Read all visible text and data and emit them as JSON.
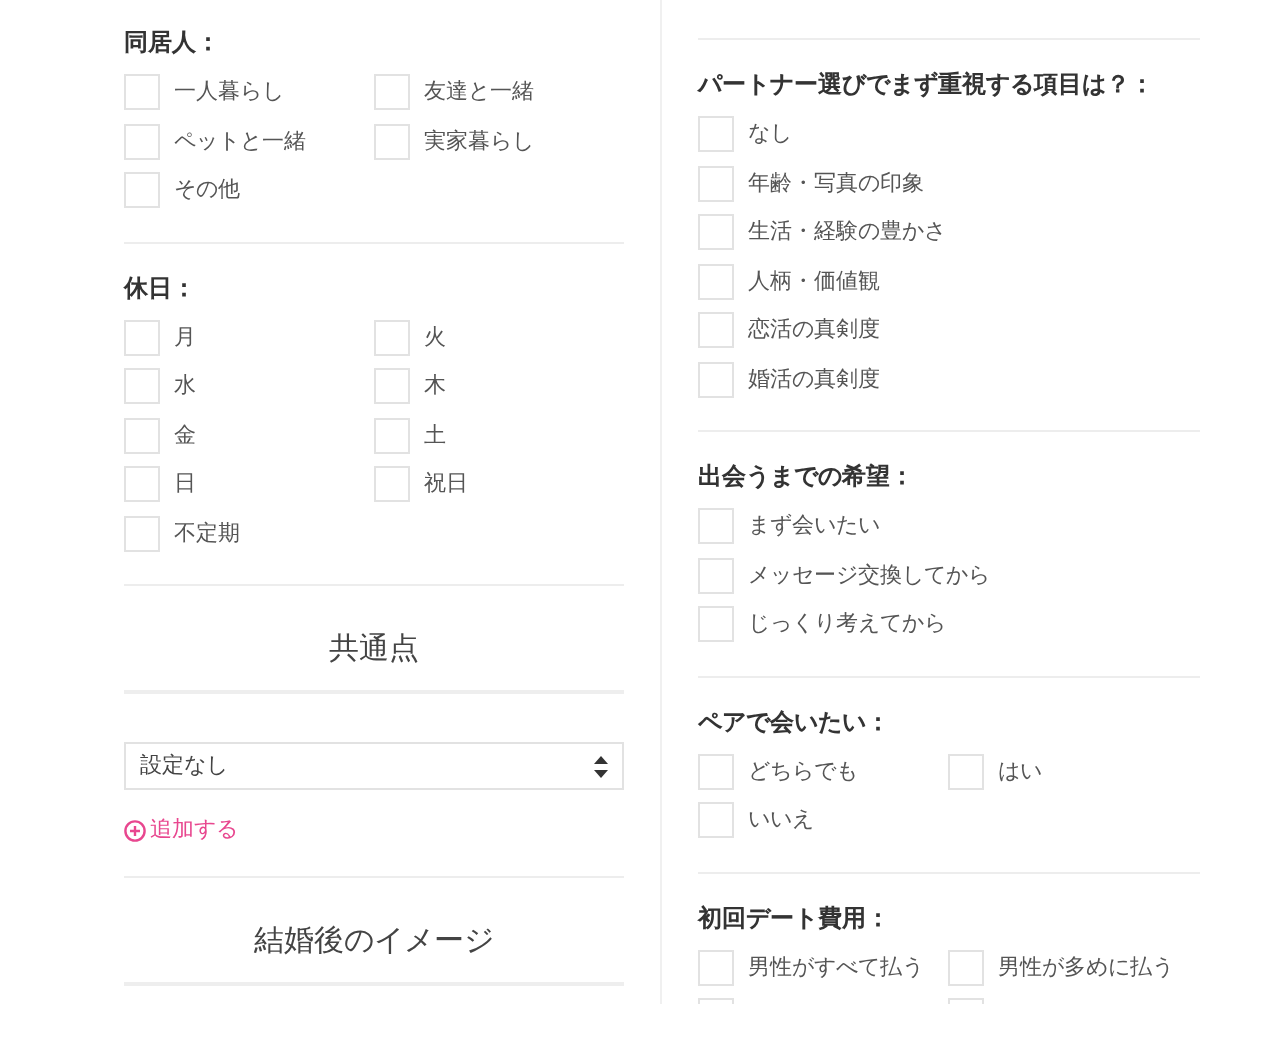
{
  "left": [
    {
      "kind": "checkbox_grid",
      "label": "同居人：",
      "items": [
        {
          "label": "一人暮らし",
          "checked": false
        },
        {
          "label": "友達と一緒",
          "checked": false
        },
        {
          "label": "ペットと一緒",
          "checked": false
        },
        {
          "label": "実家暮らし",
          "checked": false
        },
        {
          "label": "その他",
          "checked": false
        }
      ]
    },
    {
      "kind": "checkbox_grid",
      "label": "休日：",
      "items": [
        {
          "label": "月",
          "checked": false
        },
        {
          "label": "火",
          "checked": false
        },
        {
          "label": "水",
          "checked": false
        },
        {
          "label": "木",
          "checked": false
        },
        {
          "label": "金",
          "checked": false
        },
        {
          "label": "土",
          "checked": false
        },
        {
          "label": "日",
          "checked": false
        },
        {
          "label": "祝日",
          "checked": false
        },
        {
          "label": "不定期",
          "checked": false
        }
      ]
    },
    {
      "kind": "heading",
      "text": "共通点"
    },
    {
      "kind": "select",
      "value": "設定なし",
      "add_link": "追加する"
    },
    {
      "kind": "heading",
      "text": "結婚後のイメージ"
    }
  ],
  "right": [
    {
      "kind": "checkbox_list",
      "label": "パートナー選びでまず重視する項目は？：",
      "items": [
        {
          "label": "なし",
          "checked": false
        },
        {
          "label": "年齢・写真の印象",
          "checked": false
        },
        {
          "label": "生活・経験の豊かさ",
          "checked": false
        },
        {
          "label": "人柄・価値観",
          "checked": false
        },
        {
          "label": "恋活の真剣度",
          "checked": false
        },
        {
          "label": "婚活の真剣度",
          "checked": false
        }
      ]
    },
    {
      "kind": "checkbox_list",
      "label": "出会うまでの希望：",
      "items": [
        {
          "label": "まず会いたい",
          "checked": false
        },
        {
          "label": "メッセージ交換してから",
          "checked": false
        },
        {
          "label": "じっくり考えてから",
          "checked": false
        }
      ]
    },
    {
      "kind": "checkbox_grid",
      "label": "ペアで会いたい：",
      "items": [
        {
          "label": "どちらでも",
          "checked": false
        },
        {
          "label": "はい",
          "checked": false
        },
        {
          "label": "いいえ",
          "checked": false
        }
      ]
    },
    {
      "kind": "checkbox_grid",
      "label": "初回デート費用：",
      "items": [
        {
          "label": "男性がすべて払う",
          "checked": false
        },
        {
          "label": "男性が多めに払う",
          "checked": false
        },
        {
          "checked": false
        },
        {
          "checked": false
        }
      ]
    }
  ]
}
